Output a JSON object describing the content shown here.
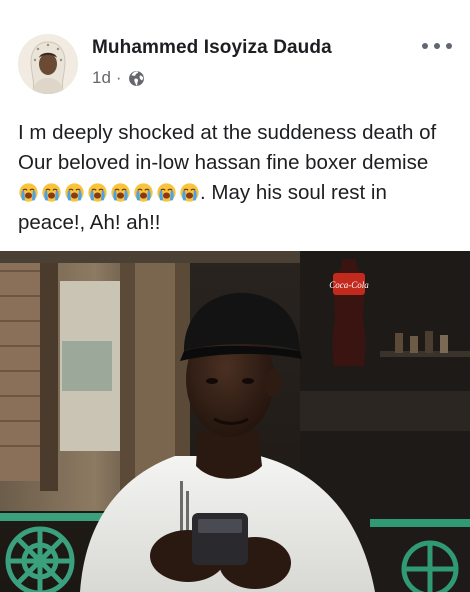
{
  "post": {
    "author": "Muhammed Isoyiza Dauda",
    "time": "1d",
    "separator": "·",
    "privacy_icon": "globe-icon",
    "more_icon": "more-options-icon",
    "text_before": "I m deeply shocked at the suddeness death of Our beloved in-low hassan fine boxer demise",
    "emoji_name": "loudly-crying-face-emoji",
    "emoji_count": 8,
    "text_after": ". May his soul rest in peace!, Ah! ah!!",
    "photo_label": "Coca-Cola"
  },
  "colors": {
    "name": "#1c1e21",
    "meta": "#65676b",
    "emoji_face": "#f9c33c",
    "tears": "#4aa3e8"
  }
}
